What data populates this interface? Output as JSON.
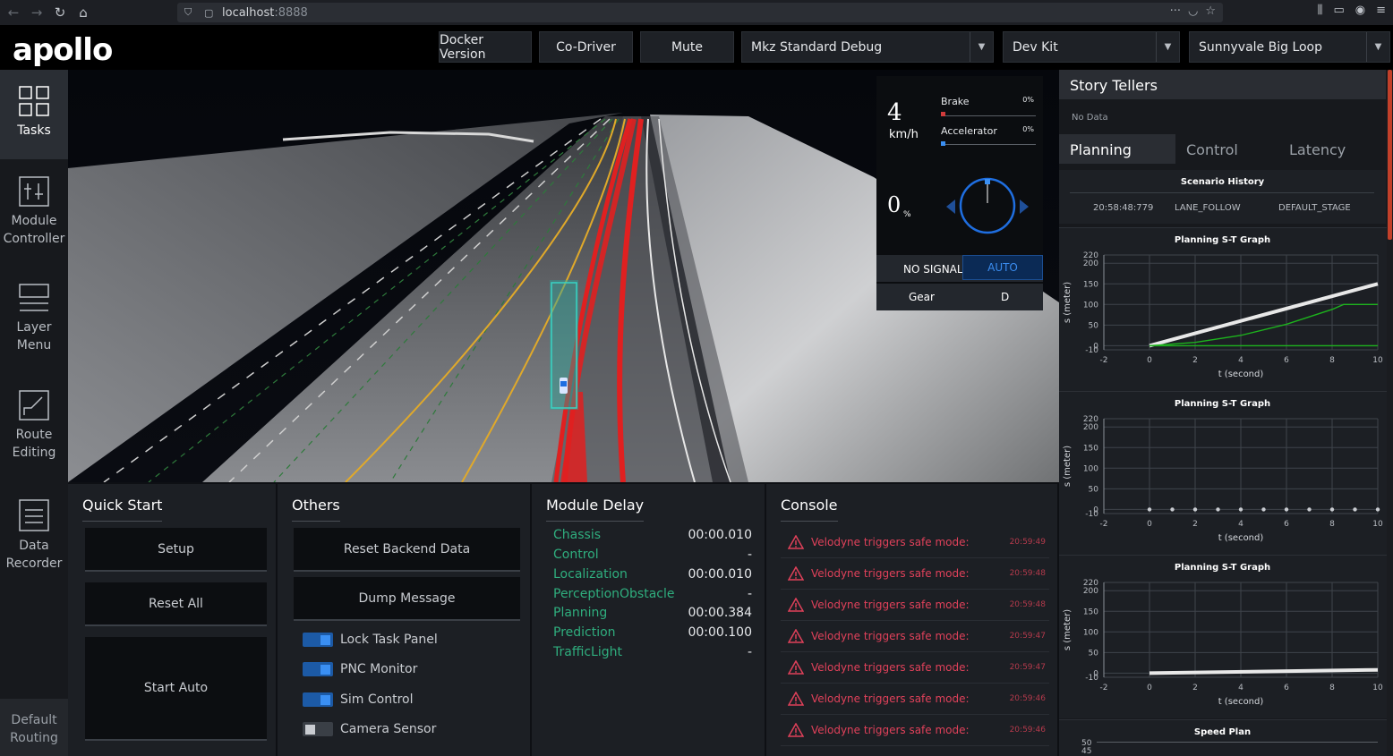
{
  "browser": {
    "url_host": "localhost",
    "url_port": ":8888"
  },
  "header": {
    "logo": "apollo",
    "buttons": [
      "Docker Version",
      "Co-Driver",
      "Mute"
    ],
    "mode_select": "Mkz Standard Debug",
    "vehicle_select": "Dev Kit",
    "map_select": "Sunnyvale Big Loop"
  },
  "sidebar": {
    "items": [
      {
        "label": "Tasks",
        "icon": "grid-icon",
        "active": true
      },
      {
        "label": "Module\nController",
        "icon": "sliders-icon"
      },
      {
        "label": "Layer\nMenu",
        "icon": "layers-icon"
      },
      {
        "label": "Route\nEditing",
        "icon": "route-icon"
      },
      {
        "label": "Data\nRecorder",
        "icon": "document-icon"
      }
    ],
    "default_routing": "Default\nRouting"
  },
  "dashboard": {
    "speed": "4",
    "speed_unit": "km/h",
    "throttle": "0",
    "throttle_unit": "%",
    "brake_label": "Brake",
    "brake_pct": "0%",
    "accel_label": "Accelerator",
    "accel_pct": "0%",
    "signal": "NO SIGNAL",
    "mode": "AUTO",
    "gear_label": "Gear",
    "gear_value": "D",
    "colors": {
      "brake": "#d13b3b",
      "accel": "#3a8ff3",
      "steering": "#1f6ee0"
    }
  },
  "quick_start": {
    "title": "Quick Start",
    "buttons": [
      "Setup",
      "Reset All",
      "Start Auto"
    ]
  },
  "others": {
    "title": "Others",
    "buttons": [
      "Reset Backend Data",
      "Dump Message"
    ],
    "toggles": [
      {
        "label": "Lock Task Panel",
        "on": true
      },
      {
        "label": "PNC Monitor",
        "on": true
      },
      {
        "label": "Sim Control",
        "on": true
      },
      {
        "label": "Camera Sensor",
        "on": false
      }
    ]
  },
  "module_delay": {
    "title": "Module Delay",
    "rows": [
      {
        "name": "Chassis",
        "value": "00:00.010"
      },
      {
        "name": "Control",
        "value": "-"
      },
      {
        "name": "Localization",
        "value": "00:00.010"
      },
      {
        "name": "PerceptionObstacle",
        "value": "-"
      },
      {
        "name": "Planning",
        "value": "00:00.384"
      },
      {
        "name": "Prediction",
        "value": "00:00.100"
      },
      {
        "name": "TrafficLight",
        "value": "-"
      }
    ]
  },
  "console": {
    "title": "Console",
    "rows": [
      {
        "msg": "Velodyne triggers safe mode:",
        "time": "20:59:49"
      },
      {
        "msg": "Velodyne triggers safe mode:",
        "time": "20:59:48"
      },
      {
        "msg": "Velodyne triggers safe mode:",
        "time": "20:59:48"
      },
      {
        "msg": "Velodyne triggers safe mode:",
        "time": "20:59:47"
      },
      {
        "msg": "Velodyne triggers safe mode:",
        "time": "20:59:47"
      },
      {
        "msg": "Velodyne triggers safe mode:",
        "time": "20:59:46"
      },
      {
        "msg": "Velodyne triggers safe mode:",
        "time": "20:59:46"
      }
    ]
  },
  "right_panel": {
    "story_title": "Story Tellers",
    "story_nodata": "No Data",
    "tabs": [
      "Planning",
      "Control",
      "Latency"
    ],
    "active_tab": "Planning",
    "scenario_title": "Scenario History",
    "scenario_row": {
      "time": "20:58:48:779",
      "scenario": "LANE_FOLLOW",
      "stage": "DEFAULT_STAGE"
    },
    "speed_plan_title": "Speed Plan",
    "speed_plan_ticks": [
      "50",
      "45"
    ]
  },
  "chart_data": [
    {
      "type": "line",
      "title": "Planning S-T Graph",
      "xlabel": "t (second)",
      "ylabel": "s (meter)",
      "xlim": [
        -2,
        10
      ],
      "ylim": [
        -10,
        220
      ],
      "xticks": [
        "-2",
        "0",
        "2",
        "4",
        "6",
        "8",
        "10"
      ],
      "yticks": [
        "220",
        "200",
        "150",
        "100",
        "50",
        "0",
        "-10"
      ],
      "series": [
        {
          "color": "#e8e8e8",
          "x": [
            0,
            10
          ],
          "y": [
            0,
            150
          ]
        },
        {
          "color": "#1db31d",
          "x": [
            0,
            2,
            4,
            6,
            8,
            8.5,
            10
          ],
          "y": [
            0,
            8,
            25,
            52,
            88,
            100,
            100
          ]
        },
        {
          "color": "#1db31d",
          "x": [
            0,
            10
          ],
          "y": [
            0,
            0
          ]
        }
      ]
    },
    {
      "type": "scatter",
      "title": "Planning S-T Graph",
      "xlabel": "t (second)",
      "ylabel": "s (meter)",
      "xlim": [
        -2,
        10
      ],
      "ylim": [
        -10,
        220
      ],
      "xticks": [
        "-2",
        "0",
        "2",
        "4",
        "6",
        "8",
        "10"
      ],
      "yticks": [
        "220",
        "200",
        "150",
        "100",
        "50",
        "0",
        "-10"
      ],
      "series": [
        {
          "color": "#c9ccd1",
          "x": [
            0,
            1,
            2,
            3,
            4,
            5,
            6,
            7,
            8,
            9,
            10
          ],
          "y": [
            0,
            0,
            0,
            0,
            0,
            0,
            0,
            0,
            0,
            0,
            0
          ]
        }
      ]
    },
    {
      "type": "line",
      "title": "Planning S-T Graph",
      "xlabel": "t (second)",
      "ylabel": "s (meter)",
      "xlim": [
        -2,
        10
      ],
      "ylim": [
        -10,
        220
      ],
      "xticks": [
        "-2",
        "0",
        "2",
        "4",
        "6",
        "8",
        "10"
      ],
      "yticks": [
        "220",
        "200",
        "150",
        "100",
        "50",
        "0",
        "-10"
      ],
      "series": [
        {
          "color": "#e8e8e8",
          "x": [
            0,
            10
          ],
          "y": [
            0,
            8
          ]
        }
      ]
    }
  ]
}
